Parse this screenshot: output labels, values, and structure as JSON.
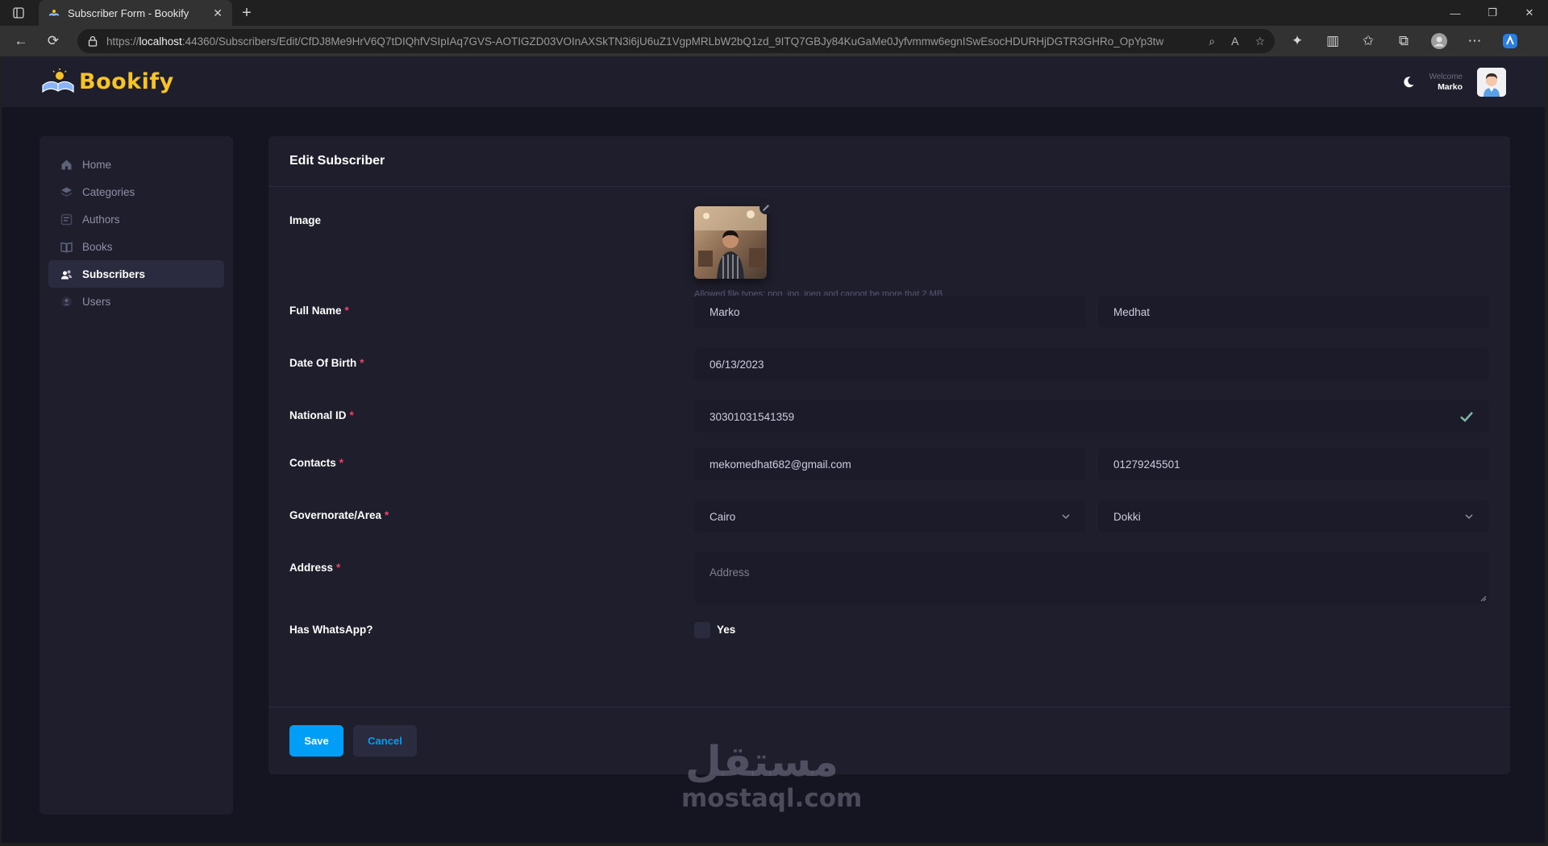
{
  "browser": {
    "tab_title": "Subscriber Form - Bookify",
    "url_prefix": "https://",
    "url_host": "localhost",
    "url_rest": ":44360/Subscribers/Edit/CfDJ8Me9HrV6Q7tDIQhfVSIpIAq7GVS-AOTIGZD03VOInAXSkTN3i6jU6uZ1VgpMRLbW2bQ1zd_9ITQ7GBJy84KuGaMe0Jyfvmmw6egnISwEsocHDURHjDGTR3GHRo_OpYp3tw"
  },
  "header": {
    "logo_text": "Bookify",
    "welcome": "Welcome",
    "user_name": "Marko"
  },
  "sidebar": {
    "items": [
      {
        "label": "Home",
        "icon": "home-icon"
      },
      {
        "label": "Categories",
        "icon": "layers-icon"
      },
      {
        "label": "Authors",
        "icon": "authors-icon"
      },
      {
        "label": "Books",
        "icon": "book-icon"
      },
      {
        "label": "Subscribers",
        "icon": "subscribers-icon",
        "active": true
      },
      {
        "label": "Users",
        "icon": "user-icon"
      }
    ]
  },
  "form": {
    "title": "Edit Subscriber",
    "image_label": "Image",
    "image_hint": "Allowed file types: png, jpg, jpeg and cannot be more that 2 MB",
    "full_name_label": "Full Name",
    "first_name": "Marko",
    "last_name": "Medhat",
    "dob_label": "Date Of Birth",
    "dob_value": "06/13/2023",
    "national_id_label": "National ID",
    "national_id_value": "30301031541359",
    "contacts_label": "Contacts",
    "email_value": "mekomedhat682@gmail.com",
    "phone_value": "01279245501",
    "gov_area_label": "Governorate/Area",
    "governorate_value": "Cairo",
    "area_value": "Dokki",
    "address_label": "Address",
    "address_placeholder": "Address",
    "whatsapp_label": "Has WhatsApp?",
    "whatsapp_option": "Yes",
    "required_mark": "*",
    "save_label": "Save",
    "cancel_label": "Cancel"
  },
  "watermark": {
    "arabic": "مستقل",
    "latin": "mostaql.com"
  },
  "colors": {
    "primary": "#009ef7",
    "brand_yellow": "#f7c325",
    "required": "#f1416c",
    "success": "#50cd89"
  }
}
